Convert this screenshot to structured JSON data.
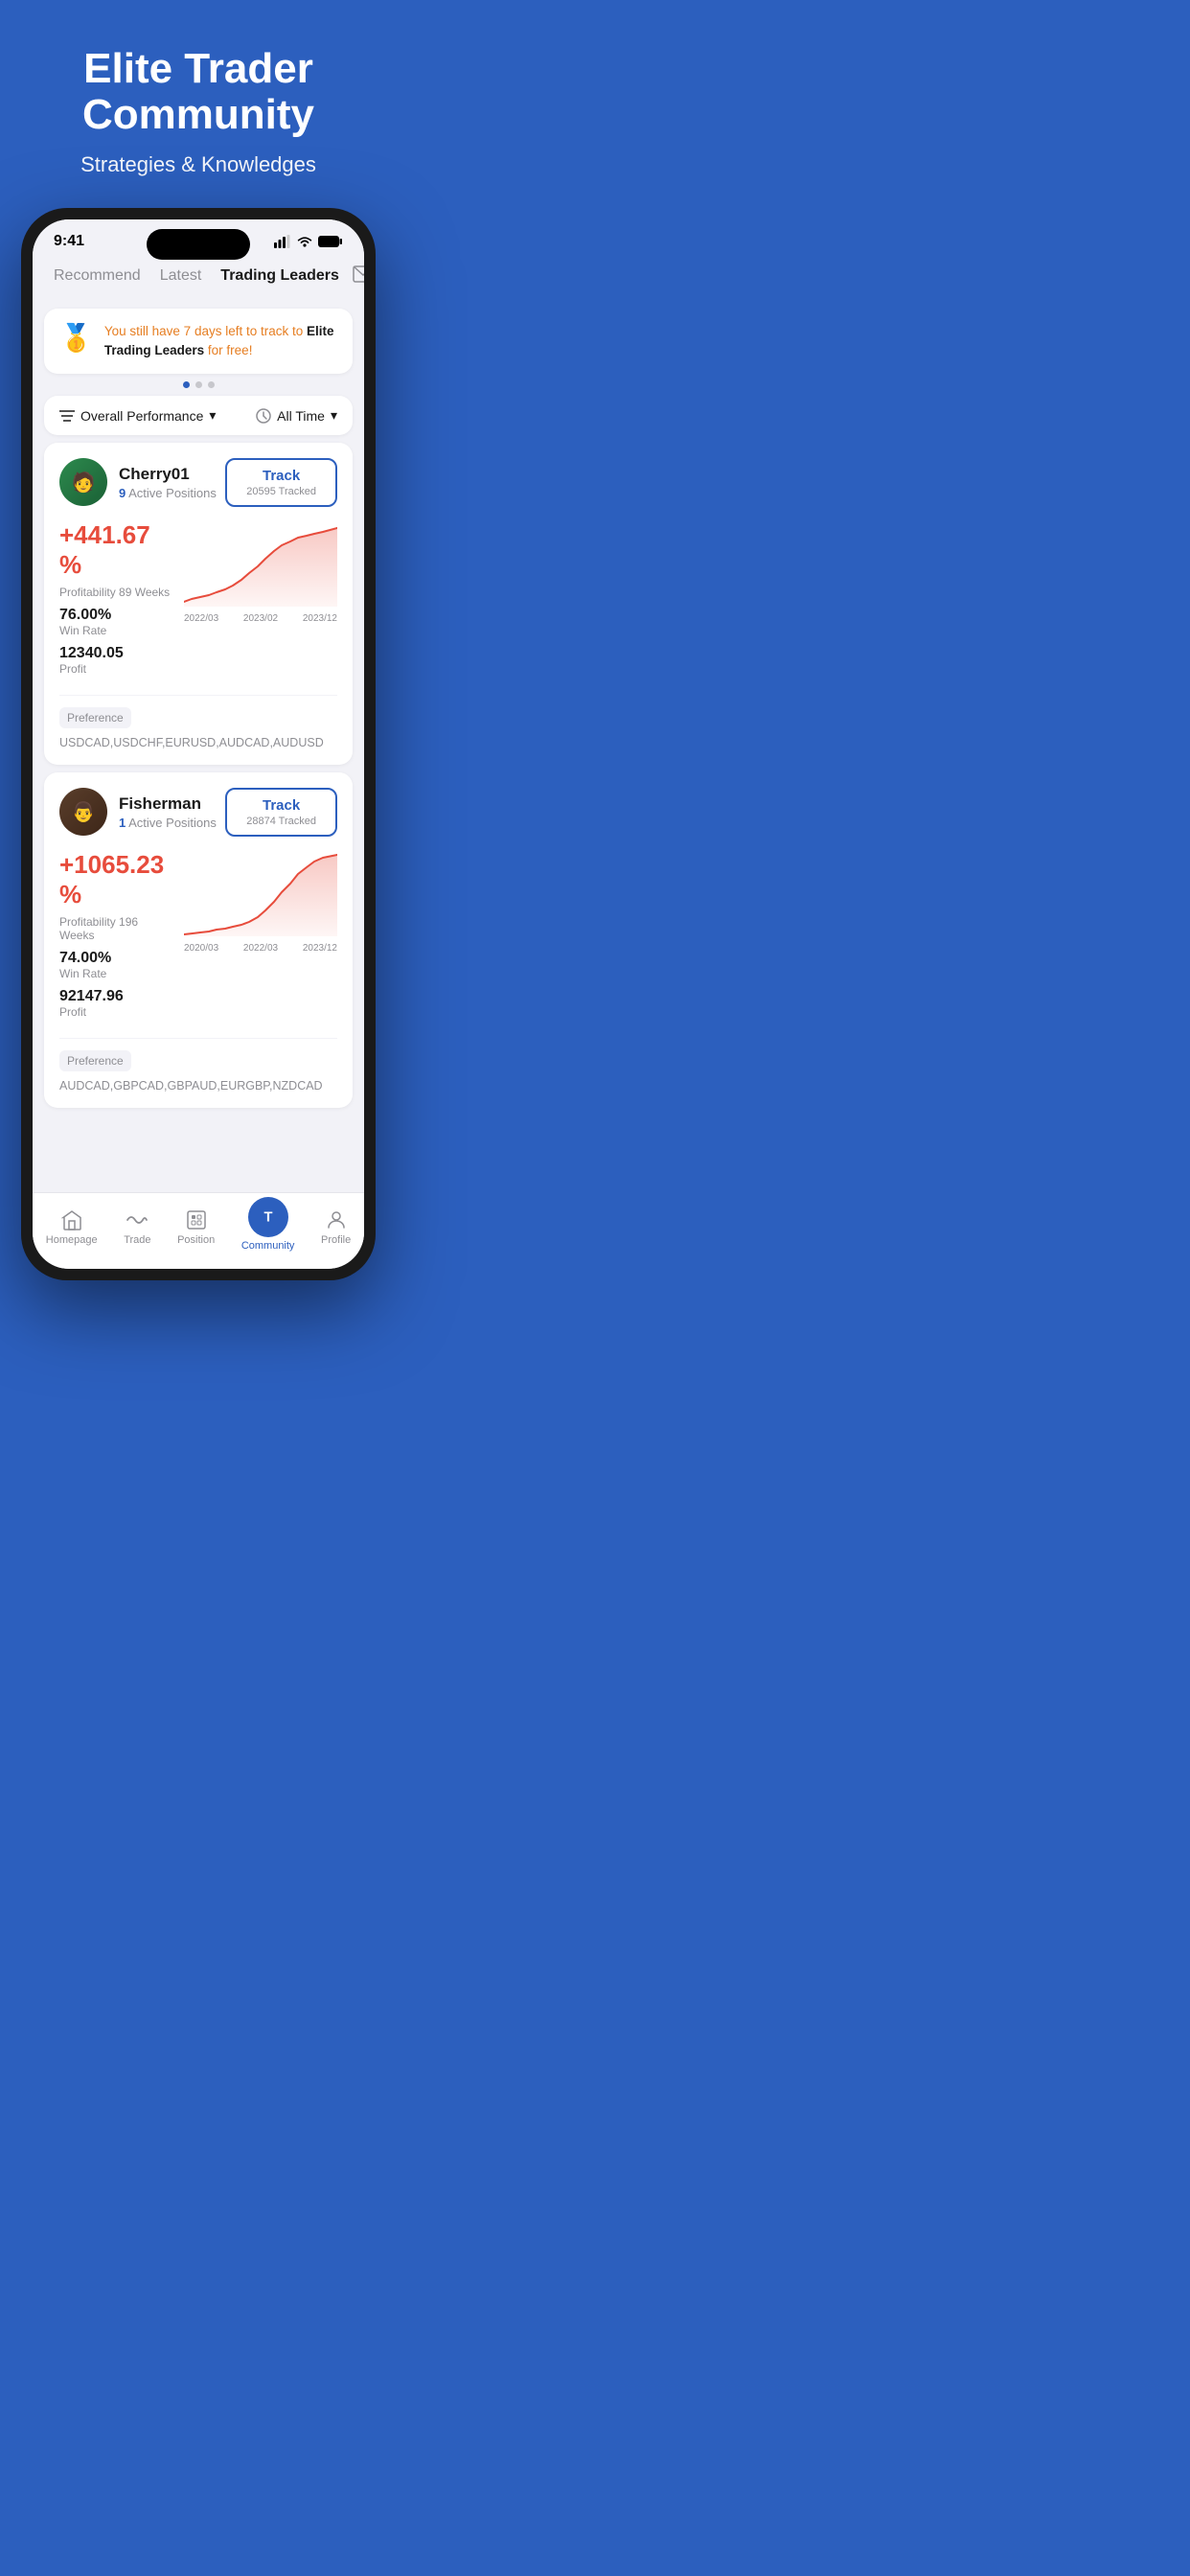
{
  "hero": {
    "title": "Elite Trader Community",
    "subtitle": "Strategies & Knowledges"
  },
  "status_bar": {
    "time": "9:41"
  },
  "top_nav": {
    "tabs": [
      {
        "id": "recommend",
        "label": "Recommend",
        "active": false
      },
      {
        "id": "latest",
        "label": "Latest",
        "active": false
      },
      {
        "id": "trading_leaders",
        "label": "Trading Leaders",
        "active": true
      }
    ]
  },
  "banner": {
    "icon": "🥇",
    "text_highlight": "You still have 7 days left to track to",
    "text_bold": "Elite Trading Leaders",
    "text_suffix": "for free!"
  },
  "filter": {
    "performance_label": "Overall Performance",
    "time_label": "All Time"
  },
  "traders": [
    {
      "id": "cherry01",
      "name": "Cherry01",
      "active_positions": "9",
      "active_positions_label": "Active Positions",
      "track_label": "Track",
      "tracked_count": "20595 Tracked",
      "profit_pct": "+441.67 %",
      "profitability_label": "Profitability",
      "profitability_weeks": "89 Weeks",
      "win_rate": "76.00%",
      "win_rate_label": "Win Rate",
      "profit": "12340.05",
      "profit_label": "Profit",
      "preference_label": "Preference",
      "preference_pairs": "USDCAD,USDCHF,EURUSD,AUDCAD,AUDUSD",
      "chart_labels": [
        "2022/03",
        "2023/02",
        "2023/12"
      ],
      "chart_data": [
        5,
        8,
        10,
        12,
        15,
        18,
        20,
        22,
        28,
        35,
        45,
        52,
        60,
        65,
        70,
        78,
        82,
        88,
        90
      ]
    },
    {
      "id": "fisherman",
      "name": "Fisherman",
      "active_positions": "1",
      "active_positions_label": "Active Positions",
      "track_label": "Track",
      "tracked_count": "28874 Tracked",
      "profit_pct": "+1065.23 %",
      "profitability_label": "Profitability",
      "profitability_weeks": "196 Weeks",
      "win_rate": "74.00%",
      "win_rate_label": "Win Rate",
      "profit": "92147.96",
      "profit_label": "Profit",
      "preference_label": "Preference",
      "preference_pairs": "AUDCAD,GBPCAD,GBPAUD,EURGBP,NZDCAD",
      "chart_labels": [
        "2020/03",
        "2022/03",
        "2023/12"
      ],
      "chart_data": [
        2,
        3,
        5,
        6,
        8,
        10,
        12,
        15,
        18,
        22,
        28,
        35,
        45,
        55,
        65,
        78,
        88,
        95,
        100
      ]
    }
  ],
  "bottom_nav": {
    "items": [
      {
        "id": "homepage",
        "label": "Homepage",
        "icon": "⌂",
        "active": false
      },
      {
        "id": "trade",
        "label": "Trade",
        "icon": "〜",
        "active": false
      },
      {
        "id": "position",
        "label": "Position",
        "icon": "▣",
        "active": false
      },
      {
        "id": "community",
        "label": "Community",
        "icon": "T",
        "active": true
      },
      {
        "id": "profile",
        "label": "Profile",
        "icon": "○",
        "active": false
      }
    ]
  }
}
